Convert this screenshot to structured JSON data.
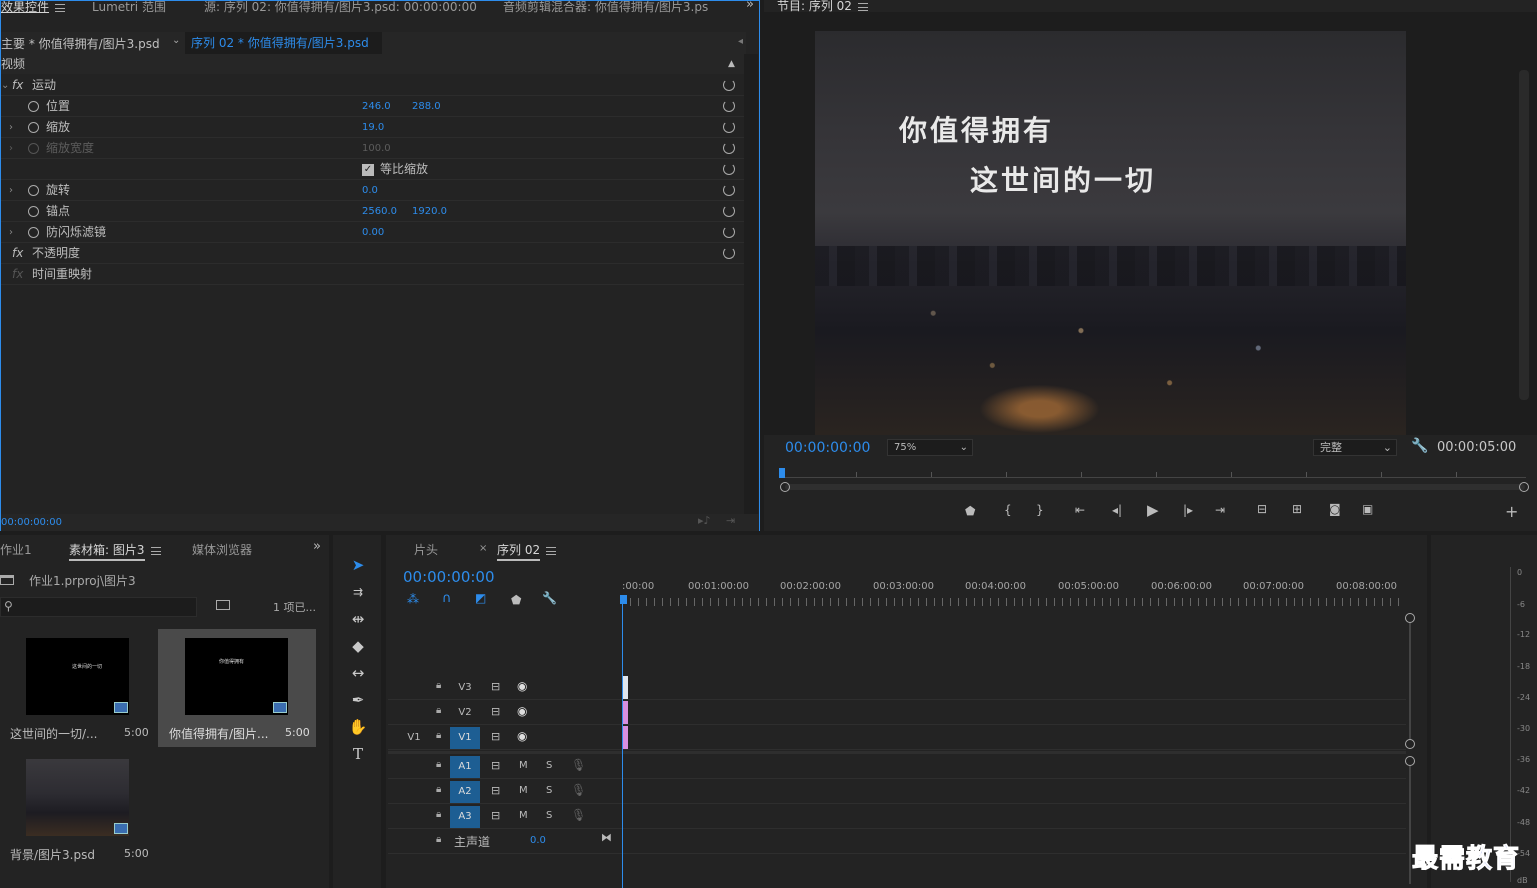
{
  "effect_controls": {
    "tabs": [
      "效果控件",
      "Lumetri 范围",
      "源: 序列 02: 你值得拥有/图片3.psd: 00:00:00:00",
      "音频剪辑混合器: 你值得拥有/图片3.ps"
    ],
    "master_clip": "主要 * 你值得拥有/图片3.psd",
    "sequence_clip": "序列 02 * 你值得拥有/图片3.psd",
    "section_video": "视频",
    "motion": "运动",
    "position_label": "位置",
    "position_x": "246.0",
    "position_y": "288.0",
    "scale_label": "缩放",
    "scale_value": "19.0",
    "scale_width_label": "缩放宽度",
    "scale_width_value": "100.0",
    "uniform_scale": "等比缩放",
    "rotation_label": "旋转",
    "rotation_value": "0.0",
    "anchor_label": "锚点",
    "anchor_x": "2560.0",
    "anchor_y": "1920.0",
    "antiflicker_label": "防闪烁滤镜",
    "antiflicker_value": "0.00",
    "opacity": "不透明度",
    "time_remap": "时间重映射",
    "timecode": "00:00:00:00",
    "fx_symbol": "fx"
  },
  "program_monitor": {
    "title": "节目: 序列 02",
    "overlay_line1": "你值得拥有",
    "overlay_line2": "这世间的一切",
    "timecode": "00:00:00:00",
    "zoom": "75%",
    "quality": "完整",
    "duration": "00:00:05:00"
  },
  "project_panel": {
    "tabs": [
      "作业1",
      "素材箱: 图片3",
      "媒体浏览器"
    ],
    "path": "作业1.prproj\\图片3",
    "search_placeholder": "",
    "count": "1 项已...",
    "items": [
      {
        "name": "这世间的一切/...",
        "duration": "5:00",
        "thumb_text": "这世间的一切"
      },
      {
        "name": "你值得拥有/图片...",
        "duration": "5:00",
        "thumb_text": "你值得拥有"
      },
      {
        "name": "背景/图片3.psd",
        "duration": "5:00"
      }
    ]
  },
  "timeline": {
    "tabs": [
      "片头",
      "序列 02"
    ],
    "timecode": "00:00:00:00",
    "ruler": [
      ":00:00",
      "00:01:00:00",
      "00:02:00:00",
      "00:03:00:00",
      "00:04:00:00",
      "00:05:00:00",
      "00:06:00:00",
      "00:07:00:00",
      "00:08:00:00"
    ],
    "video_tracks": [
      "V3",
      "V2",
      "V1"
    ],
    "source_patch": "V1",
    "audio_tracks": [
      "A1",
      "A2",
      "A3"
    ],
    "mute": "M",
    "solo": "S",
    "master_label": "主声道",
    "master_value": "0.0"
  },
  "audio_meter": {
    "labels": [
      "0",
      "-6",
      "-12",
      "-18",
      "-24",
      "-30",
      "-36",
      "-42",
      "-48",
      "-54",
      "dB"
    ]
  },
  "watermark": "最需教育",
  "colors": {
    "accent": "#2d8ceb",
    "track_on": "#1d5e93",
    "clip_video": "#d88fe0",
    "panel_bg": "#232323"
  }
}
